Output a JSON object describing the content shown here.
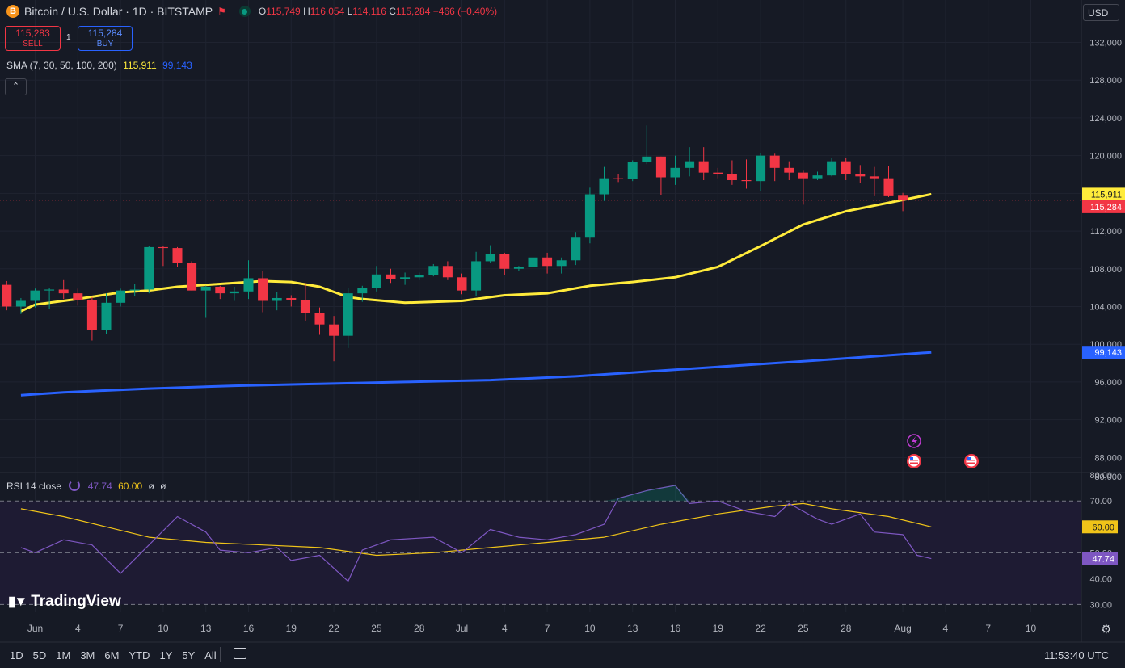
{
  "header": {
    "symbol_icon": "B",
    "title": "Bitcoin / U.S. Dollar · 1D · BITSTAMP",
    "open_label": "O",
    "open": "115,749",
    "high_label": "H",
    "high": "116,054",
    "low_label": "L",
    "low": "114,116",
    "close_label": "C",
    "close": "115,284",
    "change": "−466 (−0.40%)"
  },
  "trade": {
    "sell_price": "115,283",
    "sell_label": "SELL",
    "spread": "1",
    "buy_price": "115,284",
    "buy_label": "BUY"
  },
  "indicators": {
    "sma_label": "SMA (7, 30, 50, 100, 200)",
    "sma_v1": "115,911",
    "sma_v2": "99,143",
    "collapse_icon": "chevron-up-icon",
    "rsi_label": "RSI 14 close",
    "rsi_value": "47.74",
    "rsi_ma_value": "60.00",
    "rsi_extra1": "ø",
    "rsi_extra2": "ø"
  },
  "currency": "USD",
  "branding": "TradingView",
  "ranges": [
    "1D",
    "5D",
    "1M",
    "3M",
    "6M",
    "YTD",
    "1Y",
    "5Y",
    "All"
  ],
  "clock": "11:53:40 UTC",
  "colors": {
    "up": "#089981",
    "down": "#f23645",
    "sma_fast": "#ffeb3b",
    "sma_slow": "#2962ff",
    "rsi": "#7e57c2",
    "rsi_ma": "#f0c419"
  },
  "chart_data": {
    "type": "candlestick",
    "title": "Bitcoin / U.S. Dollar · 1D · BITSTAMP",
    "x_axis": {
      "tick_labels": [
        "Jun",
        "4",
        "7",
        "10",
        "13",
        "16",
        "19",
        "22",
        "25",
        "28",
        "Jul",
        "4",
        "7",
        "10",
        "13",
        "16",
        "19",
        "22",
        "25",
        "28",
        "Aug",
        "4",
        "7",
        "10"
      ],
      "tick_dates": [
        "2025-06-01",
        "2025-06-04",
        "2025-06-07",
        "2025-06-10",
        "2025-06-13",
        "2025-06-16",
        "2025-06-19",
        "2025-06-22",
        "2025-06-25",
        "2025-06-28",
        "2025-07-01",
        "2025-07-04",
        "2025-07-07",
        "2025-07-10",
        "2025-07-13",
        "2025-07-16",
        "2025-07-19",
        "2025-07-22",
        "2025-07-25",
        "2025-07-28",
        "2025-08-01",
        "2025-08-04",
        "2025-08-07",
        "2025-08-10"
      ]
    },
    "y_axis": {
      "ticks": [
        "132,000",
        "128,000",
        "124,000",
        "120,000",
        "116,000",
        "112,000",
        "108,000",
        "104,000",
        "100,000",
        "96,000",
        "92,000",
        "88,000",
        "80,000"
      ],
      "ylim": [
        87000,
        133500
      ]
    },
    "candles": [
      {
        "d": "2025-05-30",
        "o": 106300,
        "h": 106700,
        "l": 103600,
        "c": 104000
      },
      {
        "d": "2025-05-31",
        "o": 104000,
        "h": 104900,
        "l": 103200,
        "c": 104600
      },
      {
        "d": "2025-06-01",
        "o": 104600,
        "h": 105900,
        "l": 103900,
        "c": 105700
      },
      {
        "d": "2025-06-02",
        "o": 105700,
        "h": 106000,
        "l": 103700,
        "c": 105800
      },
      {
        "d": "2025-06-03",
        "o": 105800,
        "h": 106800,
        "l": 104800,
        "c": 105400
      },
      {
        "d": "2025-06-04",
        "o": 105400,
        "h": 105900,
        "l": 104100,
        "c": 104700
      },
      {
        "d": "2025-06-05",
        "o": 104700,
        "h": 105000,
        "l": 100400,
        "c": 101500
      },
      {
        "d": "2025-06-06",
        "o": 101500,
        "h": 105400,
        "l": 101100,
        "c": 104400
      },
      {
        "d": "2025-06-07",
        "o": 104400,
        "h": 105900,
        "l": 104000,
        "c": 105700
      },
      {
        "d": "2025-06-08",
        "o": 105700,
        "h": 106400,
        "l": 105100,
        "c": 105800
      },
      {
        "d": "2025-06-09",
        "o": 105800,
        "h": 110400,
        "l": 105400,
        "c": 110300
      },
      {
        "d": "2025-06-10",
        "o": 110300,
        "h": 110400,
        "l": 108300,
        "c": 110200
      },
      {
        "d": "2025-06-11",
        "o": 110200,
        "h": 110300,
        "l": 108200,
        "c": 108600
      },
      {
        "d": "2025-06-12",
        "o": 108600,
        "h": 108800,
        "l": 105700,
        "c": 105700
      },
      {
        "d": "2025-06-13",
        "o": 105700,
        "h": 106200,
        "l": 102800,
        "c": 106100
      },
      {
        "d": "2025-06-14",
        "o": 106100,
        "h": 106200,
        "l": 104800,
        "c": 105400
      },
      {
        "d": "2025-06-15",
        "o": 105400,
        "h": 106100,
        "l": 104600,
        "c": 105600
      },
      {
        "d": "2025-06-16",
        "o": 105600,
        "h": 108900,
        "l": 104800,
        "c": 107000
      },
      {
        "d": "2025-06-17",
        "o": 107000,
        "h": 107800,
        "l": 103400,
        "c": 104600
      },
      {
        "d": "2025-06-18",
        "o": 104600,
        "h": 105500,
        "l": 103600,
        "c": 104900
      },
      {
        "d": "2025-06-19",
        "o": 104900,
        "h": 105200,
        "l": 104000,
        "c": 104700
      },
      {
        "d": "2025-06-20",
        "o": 104700,
        "h": 106500,
        "l": 102500,
        "c": 103300
      },
      {
        "d": "2025-06-21",
        "o": 103300,
        "h": 103900,
        "l": 101000,
        "c": 102100
      },
      {
        "d": "2025-06-22",
        "o": 102100,
        "h": 103000,
        "l": 98200,
        "c": 100900
      },
      {
        "d": "2025-06-23",
        "o": 100900,
        "h": 106000,
        "l": 99600,
        "c": 105400
      },
      {
        "d": "2025-06-24",
        "o": 105400,
        "h": 106200,
        "l": 104500,
        "c": 106000
      },
      {
        "d": "2025-06-25",
        "o": 106000,
        "h": 108300,
        "l": 105600,
        "c": 107400
      },
      {
        "d": "2025-06-26",
        "o": 107400,
        "h": 108000,
        "l": 106500,
        "c": 106900
      },
      {
        "d": "2025-06-27",
        "o": 106900,
        "h": 107600,
        "l": 106300,
        "c": 107100
      },
      {
        "d": "2025-06-28",
        "o": 107100,
        "h": 107600,
        "l": 106800,
        "c": 107300
      },
      {
        "d": "2025-06-29",
        "o": 107300,
        "h": 108500,
        "l": 107200,
        "c": 108300
      },
      {
        "d": "2025-06-30",
        "o": 108300,
        "h": 108800,
        "l": 106800,
        "c": 107100
      },
      {
        "d": "2025-07-01",
        "o": 107100,
        "h": 107500,
        "l": 105300,
        "c": 105700
      },
      {
        "d": "2025-07-02",
        "o": 105700,
        "h": 109800,
        "l": 105100,
        "c": 108800
      },
      {
        "d": "2025-07-03",
        "o": 108800,
        "h": 110500,
        "l": 108600,
        "c": 109600
      },
      {
        "d": "2025-07-04",
        "o": 109600,
        "h": 109700,
        "l": 107300,
        "c": 108000
      },
      {
        "d": "2025-07-05",
        "o": 108000,
        "h": 108300,
        "l": 107800,
        "c": 108200
      },
      {
        "d": "2025-07-06",
        "o": 108200,
        "h": 109700,
        "l": 107800,
        "c": 109200
      },
      {
        "d": "2025-07-07",
        "o": 109200,
        "h": 109700,
        "l": 107500,
        "c": 108300
      },
      {
        "d": "2025-07-08",
        "o": 108300,
        "h": 109200,
        "l": 107500,
        "c": 108900
      },
      {
        "d": "2025-07-09",
        "o": 108900,
        "h": 111900,
        "l": 108400,
        "c": 111300
      },
      {
        "d": "2025-07-10",
        "o": 111300,
        "h": 116600,
        "l": 110700,
        "c": 115900
      },
      {
        "d": "2025-07-11",
        "o": 115900,
        "h": 118800,
        "l": 115200,
        "c": 117600
      },
      {
        "d": "2025-07-12",
        "o": 117600,
        "h": 118000,
        "l": 117200,
        "c": 117500
      },
      {
        "d": "2025-07-13",
        "o": 117500,
        "h": 119500,
        "l": 117300,
        "c": 119300
      },
      {
        "d": "2025-07-14",
        "o": 119300,
        "h": 123200,
        "l": 119100,
        "c": 119900
      },
      {
        "d": "2025-07-15",
        "o": 119900,
        "h": 119900,
        "l": 115800,
        "c": 117700
      },
      {
        "d": "2025-07-16",
        "o": 117700,
        "h": 120000,
        "l": 116900,
        "c": 118700
      },
      {
        "d": "2025-07-17",
        "o": 118700,
        "h": 120900,
        "l": 117800,
        "c": 119400
      },
      {
        "d": "2025-07-18",
        "o": 119400,
        "h": 120900,
        "l": 117400,
        "c": 118200
      },
      {
        "d": "2025-07-19",
        "o": 118200,
        "h": 118700,
        "l": 117600,
        "c": 118000
      },
      {
        "d": "2025-07-20",
        "o": 118000,
        "h": 119500,
        "l": 116900,
        "c": 117400
      },
      {
        "d": "2025-07-21",
        "o": 117400,
        "h": 119600,
        "l": 116500,
        "c": 117300
      },
      {
        "d": "2025-07-22",
        "o": 117300,
        "h": 120300,
        "l": 116200,
        "c": 120000
      },
      {
        "d": "2025-07-23",
        "o": 120000,
        "h": 120200,
        "l": 117300,
        "c": 118700
      },
      {
        "d": "2025-07-24",
        "o": 118700,
        "h": 119400,
        "l": 117400,
        "c": 118200
      },
      {
        "d": "2025-07-25",
        "o": 118200,
        "h": 118400,
        "l": 114800,
        "c": 117600
      },
      {
        "d": "2025-07-26",
        "o": 117600,
        "h": 118300,
        "l": 117400,
        "c": 117900
      },
      {
        "d": "2025-07-27",
        "o": 117900,
        "h": 119800,
        "l": 117800,
        "c": 119400
      },
      {
        "d": "2025-07-28",
        "o": 119400,
        "h": 119800,
        "l": 117400,
        "c": 118000
      },
      {
        "d": "2025-07-29",
        "o": 118000,
        "h": 119000,
        "l": 117100,
        "c": 117800
      },
      {
        "d": "2025-07-30",
        "o": 117800,
        "h": 118800,
        "l": 115700,
        "c": 117600
      },
      {
        "d": "2025-07-31",
        "o": 117600,
        "h": 118900,
        "l": 115600,
        "c": 115700
      },
      {
        "d": "2025-08-01",
        "o": 115749,
        "h": 116054,
        "l": 114116,
        "c": 115284
      }
    ],
    "sma_fast": [
      [
        -1,
        103500
      ],
      [
        0,
        104200
      ],
      [
        3,
        104800
      ],
      [
        6,
        105500
      ],
      [
        8,
        105700
      ],
      [
        10,
        106100
      ],
      [
        13,
        106400
      ],
      [
        16,
        106700
      ],
      [
        18,
        106600
      ],
      [
        20,
        106100
      ],
      [
        22,
        105000
      ],
      [
        23,
        104800
      ],
      [
        26,
        104400
      ],
      [
        30,
        104600
      ],
      [
        33,
        105200
      ],
      [
        36,
        105400
      ],
      [
        39,
        106200
      ],
      [
        42,
        106600
      ],
      [
        45,
        107100
      ],
      [
        48,
        108200
      ],
      [
        51,
        110400
      ],
      [
        54,
        112700
      ],
      [
        57,
        114100
      ],
      [
        60,
        115000
      ],
      [
        63,
        115911
      ]
    ],
    "sma_slow": [
      [
        -1,
        94600
      ],
      [
        2,
        94900
      ],
      [
        8,
        95300
      ],
      [
        14,
        95600
      ],
      [
        20,
        95800
      ],
      [
        26,
        96000
      ],
      [
        32,
        96200
      ],
      [
        38,
        96600
      ],
      [
        44,
        97200
      ],
      [
        50,
        97800
      ],
      [
        56,
        98400
      ],
      [
        63,
        99143
      ]
    ],
    "price_tags": {
      "sma_fast": "115,911",
      "last": "115,284",
      "sma_slow": "99,143"
    },
    "rsi": {
      "y_ticks": [
        "80.00",
        "70.00",
        "50.00",
        "40.00",
        "30.00"
      ],
      "ylim": [
        27,
        81
      ],
      "upper_band": 70,
      "mid_band": 50,
      "lower_band": 30,
      "rsi_line": [
        [
          -1,
          52
        ],
        [
          0,
          50
        ],
        [
          2,
          55
        ],
        [
          4,
          53
        ],
        [
          6,
          42
        ],
        [
          8,
          53
        ],
        [
          10,
          64
        ],
        [
          12,
          58
        ],
        [
          13,
          51
        ],
        [
          15,
          50
        ],
        [
          17,
          52
        ],
        [
          18,
          47
        ],
        [
          20,
          49
        ],
        [
          22,
          39
        ],
        [
          23,
          51
        ],
        [
          25,
          55
        ],
        [
          28,
          56
        ],
        [
          30,
          50
        ],
        [
          32,
          59
        ],
        [
          34,
          56
        ],
        [
          36,
          55
        ],
        [
          38,
          57
        ],
        [
          40,
          61
        ],
        [
          41,
          71
        ],
        [
          43,
          74
        ],
        [
          45,
          76
        ],
        [
          46,
          69
        ],
        [
          48,
          70
        ],
        [
          50,
          66
        ],
        [
          52,
          64
        ],
        [
          53,
          69
        ],
        [
          55,
          63
        ],
        [
          56,
          61
        ],
        [
          58,
          65
        ],
        [
          59,
          58
        ],
        [
          61,
          57
        ],
        [
          62,
          49
        ],
        [
          63,
          47.74
        ]
      ],
      "rsi_ma": [
        [
          -1,
          67
        ],
        [
          2,
          64
        ],
        [
          5,
          60
        ],
        [
          8,
          56
        ],
        [
          12,
          54
        ],
        [
          16,
          53
        ],
        [
          20,
          52
        ],
        [
          24,
          49
        ],
        [
          28,
          50
        ],
        [
          32,
          52
        ],
        [
          36,
          54
        ],
        [
          40,
          56
        ],
        [
          44,
          61
        ],
        [
          48,
          65
        ],
        [
          52,
          68
        ],
        [
          54,
          69
        ],
        [
          56,
          67
        ],
        [
          60,
          64
        ],
        [
          63,
          60.0
        ]
      ]
    }
  }
}
